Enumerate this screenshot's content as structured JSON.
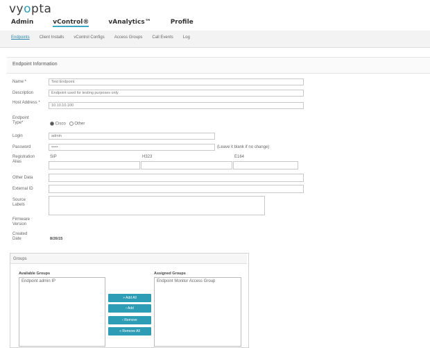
{
  "app": {
    "logo_prefix": "vy",
    "logo_o": "o",
    "logo_suffix": "pta"
  },
  "main_nav": [
    "Admin",
    "vControl®",
    "vAnalytics™",
    "Profile"
  ],
  "sub_nav": [
    "Endpoints",
    "Client Installs",
    "vControl Configs",
    "Access Groups",
    "Call Events",
    "Log"
  ],
  "section_title": "Endpoint Information",
  "form": {
    "name_label": "Name *",
    "name_value": "Test Endpoint",
    "description_label": "Description",
    "description_value": "Endpoint used for testing purposes only",
    "host_label": "Host Address *",
    "host_value": "10.10.10.100",
    "type_label": "Endpoint Type*",
    "type_option_cisco": "Cisco",
    "type_option_other": "Other",
    "login_label": "Login",
    "login_value": "admin",
    "password_label": "Password",
    "password_value": "•••••",
    "password_hint": "(Leave it blank if no change)",
    "registration_label": "Registration Alias",
    "reg_col1": "SIP",
    "reg_col2": "H323",
    "reg_col3": "E164",
    "other_data_label": "Other Data",
    "external_id_label": "External ID",
    "source_labels_label": "Source Labels",
    "firmware_label": "Firmware Version",
    "created_label": "Created Date",
    "created_value": "8/26/15"
  },
  "groups": {
    "box_title": "Groups",
    "available_title": "Available Groups",
    "available_items": [
      "Endpoint admin IP"
    ],
    "assigned_title": "Assigned Groups",
    "assigned_items": [
      "Endpoint Monitor Access Group"
    ],
    "buttons": [
      "» Add All",
      "› Add",
      "‹ Remove",
      "« Remove All"
    ]
  },
  "colors": {
    "accent": "#2d9db5"
  }
}
